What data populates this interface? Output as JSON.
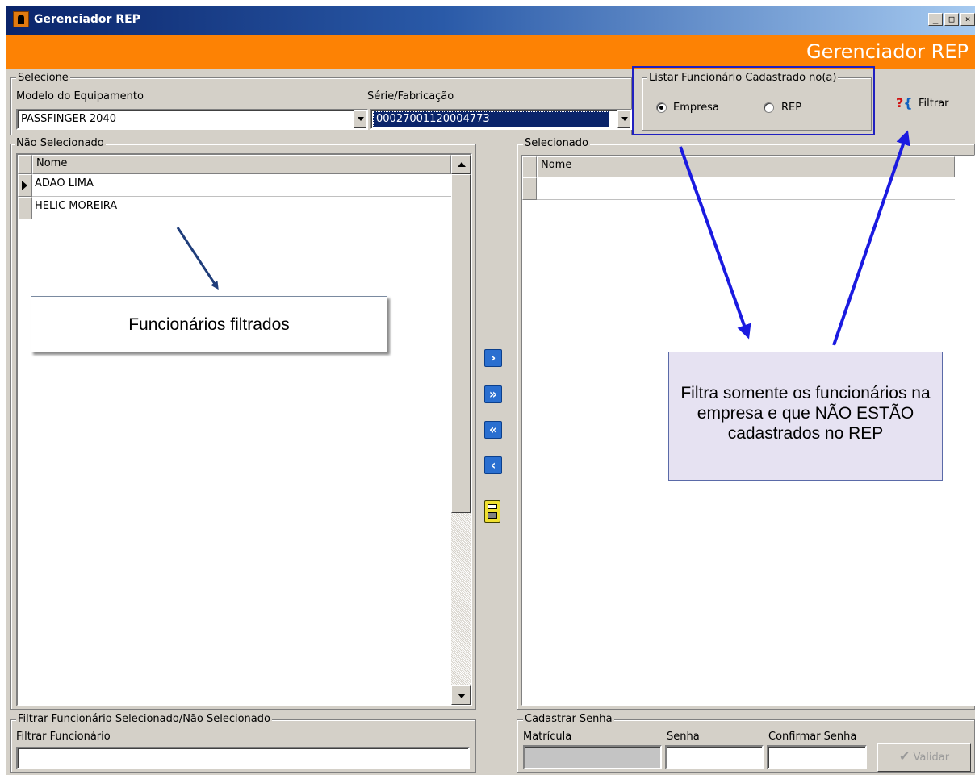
{
  "window": {
    "title": "Gerenciador REP",
    "controls": {
      "minimize": "_",
      "maximize": "□",
      "close": "×"
    }
  },
  "header": {
    "title": "Gerenciador REP",
    "accent_color": "#fd8204"
  },
  "selecione": {
    "legend": "Selecione",
    "modelo_label": "Modelo do Equipamento",
    "modelo_value": "PASSFINGER 2040",
    "serie_label": "Série/Fabricação",
    "serie_value": "00027001120004773"
  },
  "listar": {
    "legend": "Listar Funcionário Cadastrado no(a)",
    "options": [
      {
        "label": "Empresa",
        "checked": true
      },
      {
        "label": "REP",
        "checked": false
      }
    ]
  },
  "filtrar_button": {
    "label": "Filtrar",
    "icon": "?{"
  },
  "nao_selecionado": {
    "legend": "Não Selecionado",
    "column": "Nome",
    "rows": [
      "ADAO LIMA",
      "HELIC  MOREIRA"
    ]
  },
  "selecionado": {
    "legend": "Selecionado",
    "column": "Nome"
  },
  "transfer": {
    "move_one": "›",
    "move_all": "»",
    "remove_all": "«",
    "remove_one": "‹"
  },
  "filtro": {
    "legend": "Filtrar Funcionário Selecionado/Não Selecionado",
    "label": "Filtrar Funcionário",
    "value": ""
  },
  "senha": {
    "legend": "Cadastrar Senha",
    "matricula_label": "Matrícula",
    "senha_label": "Senha",
    "confirmar_label": "Confirmar Senha",
    "validar_label": "Validar"
  },
  "annotations": {
    "callout1": "Funcionários filtrados",
    "callout2": "Filtra somente os funcionários na empresa e que NÃO ESTÃO cadastrados no REP"
  }
}
